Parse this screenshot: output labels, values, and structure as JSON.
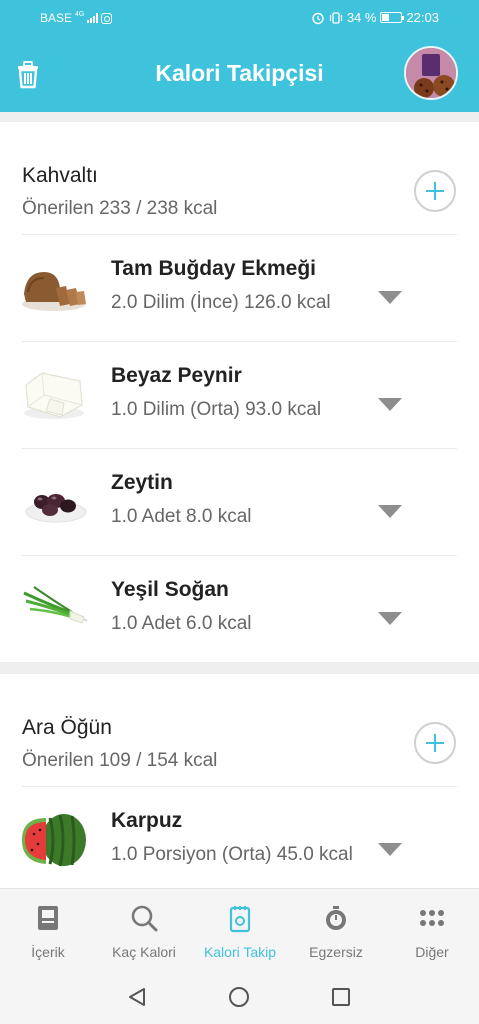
{
  "status_bar": {
    "carrier": "BASE",
    "network": "4G",
    "battery": "34 %",
    "time": "22:03"
  },
  "app_bar": {
    "title": "Kalori Takipçisi"
  },
  "sections": [
    {
      "title": "Kahvaltı",
      "subtitle": "Önerilen 233 / 238 kcal",
      "items": [
        {
          "name": "Tam Buğday Ekmeği",
          "detail": "2.0 Dilim (İnce) 126.0 kcal",
          "icon": "bread"
        },
        {
          "name": "Beyaz Peynir",
          "detail": "1.0 Dilim (Orta) 93.0 kcal",
          "icon": "cheese"
        },
        {
          "name": "Zeytin",
          "detail": "1.0 Adet 8.0 kcal",
          "icon": "olives"
        },
        {
          "name": "Yeşil Soğan",
          "detail": "1.0 Adet 6.0 kcal",
          "icon": "green-onion"
        }
      ]
    },
    {
      "title": "Ara Öğün",
      "subtitle": "Önerilen 109 / 154 kcal",
      "items": [
        {
          "name": "Karpuz",
          "detail": "1.0 Porsiyon (Orta) 45.0 kcal",
          "icon": "watermelon"
        }
      ]
    }
  ],
  "bottom_nav": [
    {
      "label": "İçerik",
      "icon": "book-icon"
    },
    {
      "label": "Kaç Kalori",
      "icon": "search-icon"
    },
    {
      "label": "Kalori Takip",
      "icon": "notepad-icon",
      "active": true
    },
    {
      "label": "Egzersiz",
      "icon": "stopwatch-icon"
    },
    {
      "label": "Diğer",
      "icon": "more-icon"
    }
  ],
  "colors": {
    "accent": "#3fc3dc",
    "muted": "#777777"
  }
}
